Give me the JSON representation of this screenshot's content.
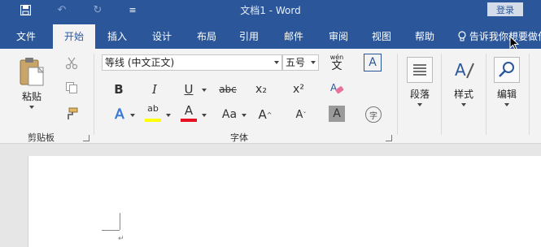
{
  "titlebar": {
    "title": "文档1 - Word",
    "login_label": "登录",
    "customize_glyph": "≡"
  },
  "tabs": [
    {
      "label": "文件"
    },
    {
      "label": "开始"
    },
    {
      "label": "插入"
    },
    {
      "label": "设计"
    },
    {
      "label": "布局"
    },
    {
      "label": "引用"
    },
    {
      "label": "邮件"
    },
    {
      "label": "审阅"
    },
    {
      "label": "视图"
    },
    {
      "label": "帮助"
    }
  ],
  "tell_me": "告诉我你想要做什",
  "ribbon": {
    "clipboard": {
      "paste_label": "粘贴",
      "group_label": "剪贴板"
    },
    "font": {
      "font_name": "等线 (中文正文)",
      "font_size": "五号",
      "bold": "B",
      "italic": "I",
      "underline": "U",
      "strike": "abc",
      "subscript": "x₂",
      "superscript": "x²",
      "text_effects": "A",
      "highlight": "ab",
      "font_color": "A",
      "change_case": "Aa",
      "grow": "A",
      "shrink": "A",
      "shading": "A",
      "phonetic_top": "wén",
      "phonetic_main": "文",
      "char_border": "A",
      "enclose": "字",
      "group_label": "字体"
    },
    "paragraph": {
      "label": "段落"
    },
    "styles": {
      "label": "样式"
    },
    "editing": {
      "label": "编辑"
    }
  },
  "document": {
    "para_mark": "↵"
  },
  "colors": {
    "accent": "#2b579a",
    "highlight": "#ffff00",
    "font_red": "#e81123"
  }
}
